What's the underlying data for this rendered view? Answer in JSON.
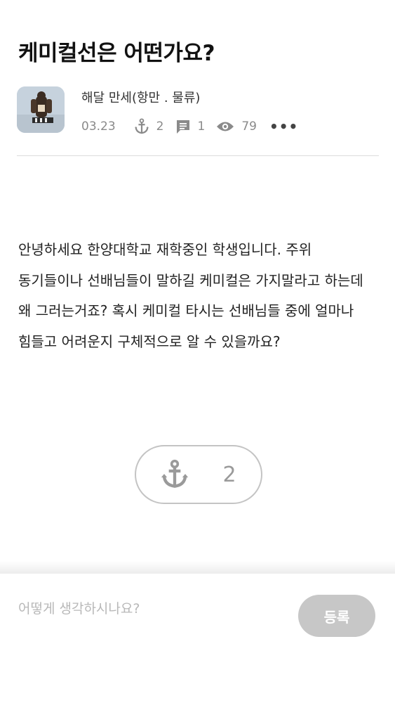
{
  "post": {
    "title": "케미컬선은 어떤가요?",
    "author": "해달 만세(항만 . 물류)",
    "date": "03.23",
    "anchor_count": "2",
    "comment_count": "1",
    "view_count": "79",
    "more": "•••",
    "body": "안녕하세요 한양대학교 재학중인 학생입니다. 주위 동기들이나 선배님들이 말하길 케미컬은 가지말라고 하는데 왜 그러는거죠? 혹시 케미컬 타시는 선배님들 중에 얼마나 힘들고 어려운지 구체적으로 알 수 있을까요?"
  },
  "reaction": {
    "anchor_count": "2"
  },
  "comment": {
    "placeholder": "어떻게 생각하시나요?",
    "submit_label": "등록"
  },
  "colors": {
    "meta_gray": "#8a8a8a",
    "button_gray": "#c7c7c7"
  },
  "icons": [
    "anchor-icon",
    "comment-icon",
    "eye-icon",
    "more-icon"
  ]
}
